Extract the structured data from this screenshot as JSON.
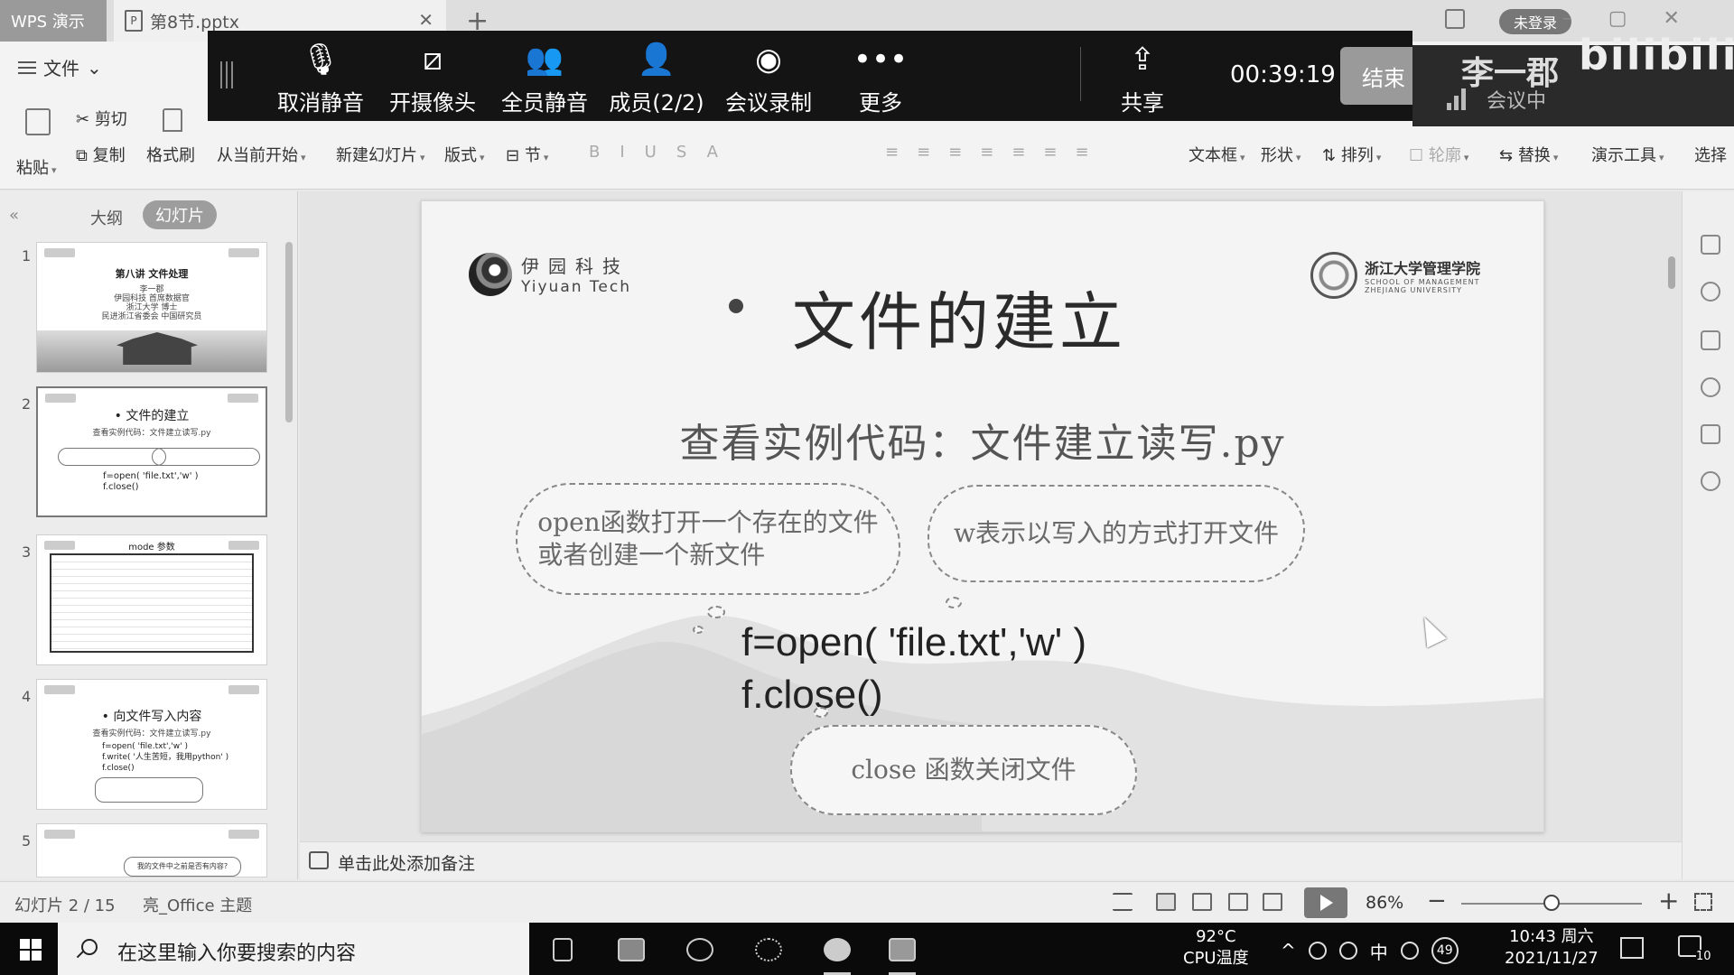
{
  "titlebar": {
    "app_tab": "WPS 演示",
    "doc_tab": "第8节.pptx",
    "login_badge": "未登录"
  },
  "ribbon": {
    "file_menu": "文件",
    "paste": "粘贴",
    "cut": "剪切",
    "copy": "复制",
    "format_painter": "格式刷",
    "from_current": "从当前开始",
    "new_slide": "新建幻灯片",
    "layout": "版式",
    "section": "节",
    "textbox": "文本框",
    "shape": "形状",
    "arrange": "排列",
    "outline": "轮廓",
    "replace": "替换",
    "presentation_tools": "演示工具",
    "select": "选择"
  },
  "meeting": {
    "buttons": [
      {
        "label": "取消静音",
        "icon": "mic-off-icon"
      },
      {
        "label": "开摄像头",
        "icon": "camera-off-icon"
      },
      {
        "label": "全员静音",
        "icon": "mute-all-icon"
      },
      {
        "label": "成员(2/2)",
        "icon": "members-icon"
      },
      {
        "label": "会议录制",
        "icon": "record-icon"
      },
      {
        "label": "更多",
        "icon": "more-icon"
      },
      {
        "label": "共享",
        "icon": "share-screen-icon"
      }
    ],
    "timer": "00:39:19",
    "end_label": "结束",
    "speaker_name": "李一郡",
    "speaker_status": "会议中",
    "watermark": "bilibili"
  },
  "left_panel": {
    "tab_outline": "大纲",
    "tab_slides": "幻灯片",
    "thumbs": [
      {
        "num": "1",
        "title": "第八讲 文件处理",
        "sub1": "李一郡",
        "sub2": "伊园科技 首席数据官",
        "sub3": "浙江大学 博士",
        "sub4": "民进浙江省委会 中国研究员"
      },
      {
        "num": "2",
        "title": "• 文件的建立",
        "sub": "查看实例代码：文件建立读写.py",
        "code": "f=open( 'file.txt','w' )\nf.close()"
      },
      {
        "num": "3",
        "title": "mode 参数"
      },
      {
        "num": "4",
        "title": "• 向文件写入内容",
        "sub": "查看实例代码：文件建立读写.py",
        "code": "f=open( 'file.txt','w' )\nf.write( '人生苦短，我用python' )\nf.close()"
      },
      {
        "num": "5",
        "sub": "我的文件中之前是否有内容?"
      }
    ]
  },
  "slide": {
    "logo_left_cn": "伊园科技",
    "logo_left_en": "Yiyuan Tech",
    "logo_right_cn": "浙江大学管理学院",
    "logo_right_en1": "SCHOOL OF MANAGEMENT",
    "logo_right_en2": "ZHEJIANG UNIVERSITY",
    "title": "文件的建立",
    "subtitle": "查看实例代码：文件建立读写.py",
    "cloud_open": "open函数打开一个存在的文件\n或者创建一个新文件",
    "cloud_w": "w表示以写入的方式打开文件",
    "cloud_close": "close 函数关闭文件",
    "code_line1": "f=open( 'file.txt','w' )",
    "code_line2": "f.close()"
  },
  "notes": {
    "placeholder": "单击此处添加备注"
  },
  "statusbar": {
    "slide_count": "幻灯片 2 / 15",
    "theme": "亮_Office 主题",
    "zoom": "86%",
    "zoom_level": 0.5
  },
  "taskbar": {
    "search_placeholder": "在这里输入你要搜索的内容",
    "temp": "92°C",
    "temp_label": "CPU温度",
    "ime": "中",
    "badge": "49",
    "time": "10:43 周六",
    "date": "2021/11/27",
    "notifications": "10"
  }
}
